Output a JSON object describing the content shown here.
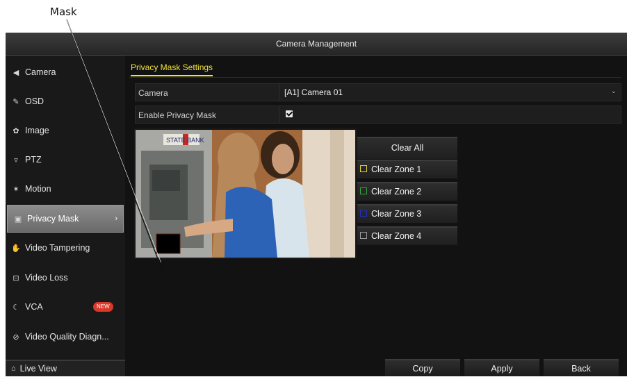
{
  "caption": "Mask",
  "window": {
    "title": "Camera Management"
  },
  "sidebar": {
    "items": [
      {
        "label": "Camera",
        "icon": "camera-icon"
      },
      {
        "label": "OSD",
        "icon": "osd-icon"
      },
      {
        "label": "Image",
        "icon": "image-icon"
      },
      {
        "label": "PTZ",
        "icon": "ptz-icon"
      },
      {
        "label": "Motion",
        "icon": "motion-icon"
      },
      {
        "label": "Privacy Mask",
        "icon": "privacy-mask-icon",
        "active": true
      },
      {
        "label": "Video Tampering",
        "icon": "video-tampering-icon"
      },
      {
        "label": "Video Loss",
        "icon": "video-loss-icon"
      },
      {
        "label": "VCA",
        "icon": "vca-icon",
        "badge": "NEW"
      },
      {
        "label": "Video Quality Diagn...",
        "icon": "video-quality-icon"
      }
    ],
    "live_view": "Live View"
  },
  "tab": {
    "label": "Privacy Mask Settings"
  },
  "form": {
    "camera_label": "Camera",
    "camera_value": "[A1] Camera 01",
    "enable_label": "Enable Privacy Mask",
    "enable_checked": true
  },
  "preview": {
    "sign_text": "STATE BANK"
  },
  "zones": {
    "clear_all": "Clear All",
    "items": [
      {
        "label": "Clear Zone 1",
        "color": "#e8d23a"
      },
      {
        "label": "Clear Zone 2",
        "color": "#2fa83a"
      },
      {
        "label": "Clear Zone 3",
        "color": "#1e2fc8"
      },
      {
        "label": "Clear Zone 4",
        "color": "#9a9a9a"
      }
    ]
  },
  "buttons": {
    "copy": "Copy",
    "apply": "Apply",
    "back": "Back"
  },
  "colors": {
    "accent": "#f0e23a",
    "badge": "#d83a2a",
    "mask": "#000000"
  }
}
